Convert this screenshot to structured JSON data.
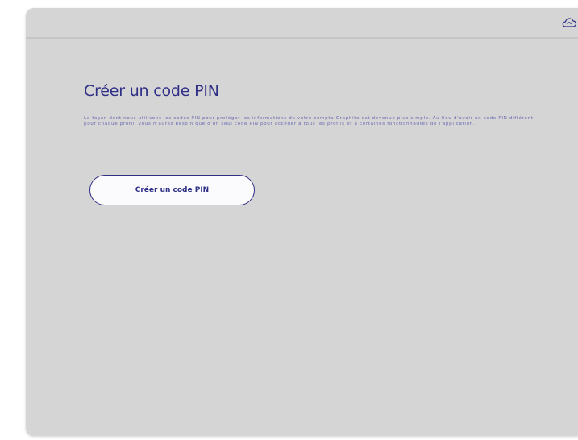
{
  "app": {
    "sync_icon": "cloud-sync-icon"
  },
  "main": {
    "title": "Créer un code PIN",
    "description": "La façon dont nous utilisons les codes PIN pour protéger les informations de votre compte Graphite est devenue plus simple. Au lieu d'avoir un code PIN différent pour chaque profil, vous n'aurez besoin que d'un seul code PIN pour accéder à tous les profils et à certaines fonctionnalités de l'application.",
    "button_label": "Créer un code PIN"
  },
  "colors": {
    "window_background": "#d6d5d6",
    "accent": "#2f2f86",
    "button_background": "#fbfbfd"
  }
}
